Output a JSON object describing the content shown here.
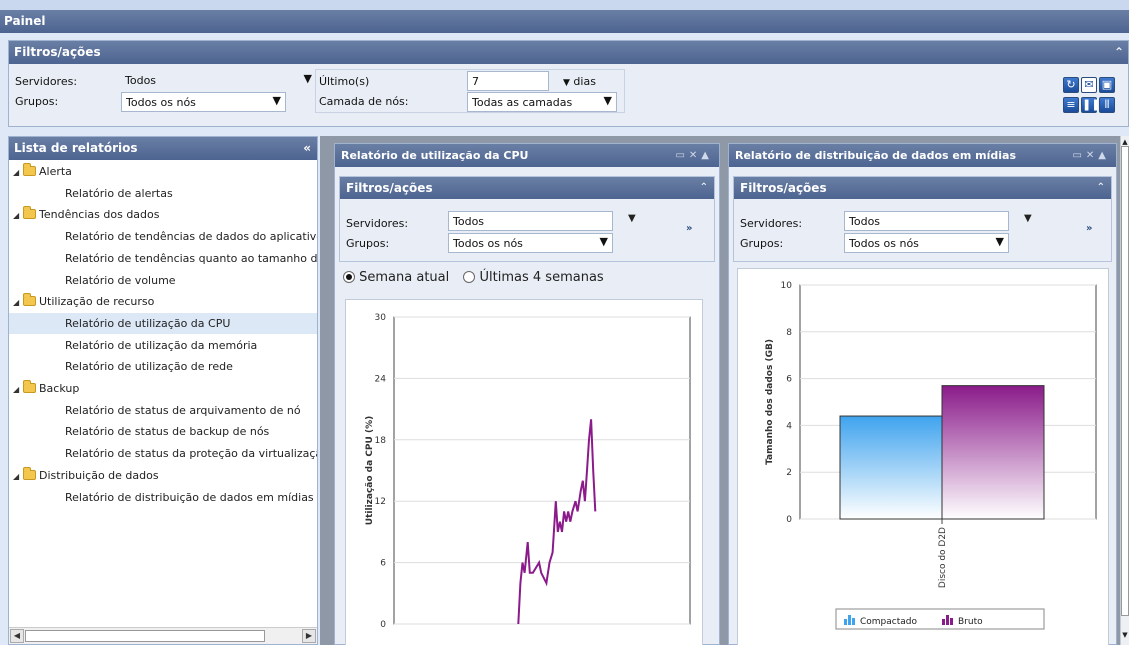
{
  "app": {
    "title": "Painel"
  },
  "filters": {
    "title": "Filtros/ações",
    "servers_label": "Servidores:",
    "servers_value": "Todos",
    "groups_label": "Grupos:",
    "groups_value": "Todos os nós",
    "last_label": "Último(s)",
    "last_value": "7",
    "last_unit": "dias",
    "tier_label": "Camada de nós:",
    "tier_value": "Todas as camadas"
  },
  "report_list": {
    "title": "Lista de relatórios",
    "items": [
      {
        "type": "folder",
        "label": "Alerta"
      },
      {
        "type": "leaf",
        "label": "Relatório de alertas"
      },
      {
        "type": "folder",
        "label": "Tendências dos dados"
      },
      {
        "type": "leaf",
        "label": "Relatório de tendências de dados do aplicativo"
      },
      {
        "type": "leaf",
        "label": "Relatório de tendências quanto ao tamanho do"
      },
      {
        "type": "leaf",
        "label": "Relatório de volume"
      },
      {
        "type": "folder",
        "label": "Utilização de recurso"
      },
      {
        "type": "leaf",
        "label": "Relatório de utilização da CPU",
        "selected": true
      },
      {
        "type": "leaf",
        "label": "Relatório de utilização da memória"
      },
      {
        "type": "leaf",
        "label": "Relatório de utilização de rede"
      },
      {
        "type": "folder",
        "label": "Backup"
      },
      {
        "type": "leaf",
        "label": "Relatório de status de arquivamento de nó"
      },
      {
        "type": "leaf",
        "label": "Relatório de status de backup de nós"
      },
      {
        "type": "leaf",
        "label": "Relatório de status da proteção da virtualização"
      },
      {
        "type": "folder",
        "label": "Distribuição de dados"
      },
      {
        "type": "leaf",
        "label": "Relatório de distribuição de dados em mídias"
      }
    ]
  },
  "cpu_panel": {
    "title": "Relatório de utilização da CPU",
    "filter_title": "Filtros/ações",
    "servers_label": "Servidores:",
    "servers_value": "Todos",
    "groups_label": "Grupos:",
    "groups_value": "Todos os nós",
    "radio_week": "Semana atual",
    "radio_4weeks": "Últimas 4 semanas"
  },
  "dist_panel": {
    "title": "Relatório de distribuição de dados em mídias",
    "filter_title": "Filtros/ações",
    "servers_label": "Servidores:",
    "servers_value": "Todos",
    "groups_label": "Grupos:",
    "groups_value": "Todos os nós"
  },
  "chart_data": [
    {
      "type": "line",
      "ylabel": "Utilização da CPU (%)",
      "xlabel": "",
      "ylim": [
        0,
        30
      ],
      "yticks": [
        0,
        6,
        12,
        18,
        24,
        30
      ],
      "color": "#8b1a8b",
      "series": [
        {
          "values": [
            [
              0.0,
              0
            ],
            [
              0.02,
              4
            ],
            [
              0.04,
              6
            ],
            [
              0.06,
              5
            ],
            [
              0.09,
              8
            ],
            [
              0.11,
              5
            ],
            [
              0.14,
              5
            ],
            [
              0.2,
              6
            ],
            [
              0.22,
              5
            ],
            [
              0.27,
              4
            ],
            [
              0.3,
              6
            ],
            [
              0.33,
              7
            ],
            [
              0.36,
              12
            ],
            [
              0.38,
              9
            ],
            [
              0.4,
              10
            ],
            [
              0.42,
              9
            ],
            [
              0.44,
              11
            ],
            [
              0.46,
              10
            ],
            [
              0.48,
              11
            ],
            [
              0.5,
              10
            ],
            [
              0.52,
              11
            ],
            [
              0.55,
              12
            ],
            [
              0.57,
              11
            ],
            [
              0.6,
              13
            ],
            [
              0.62,
              14
            ],
            [
              0.64,
              12
            ],
            [
              0.66,
              15
            ],
            [
              0.68,
              18
            ],
            [
              0.7,
              20
            ],
            [
              0.72,
              15
            ],
            [
              0.74,
              11
            ]
          ]
        }
      ]
    },
    {
      "type": "bar",
      "ylabel": "Tamanho dos dados (GB)",
      "ylim": [
        0,
        10
      ],
      "yticks": [
        0,
        2,
        4,
        6,
        8,
        10
      ],
      "categories": [
        "Disco do D2D"
      ],
      "series": [
        {
          "name": "Compactado",
          "values": [
            4.4
          ],
          "color": "#3fa3ee"
        },
        {
          "name": "Bruto",
          "values": [
            5.7
          ],
          "color": "#8a1b8a"
        }
      ]
    }
  ]
}
